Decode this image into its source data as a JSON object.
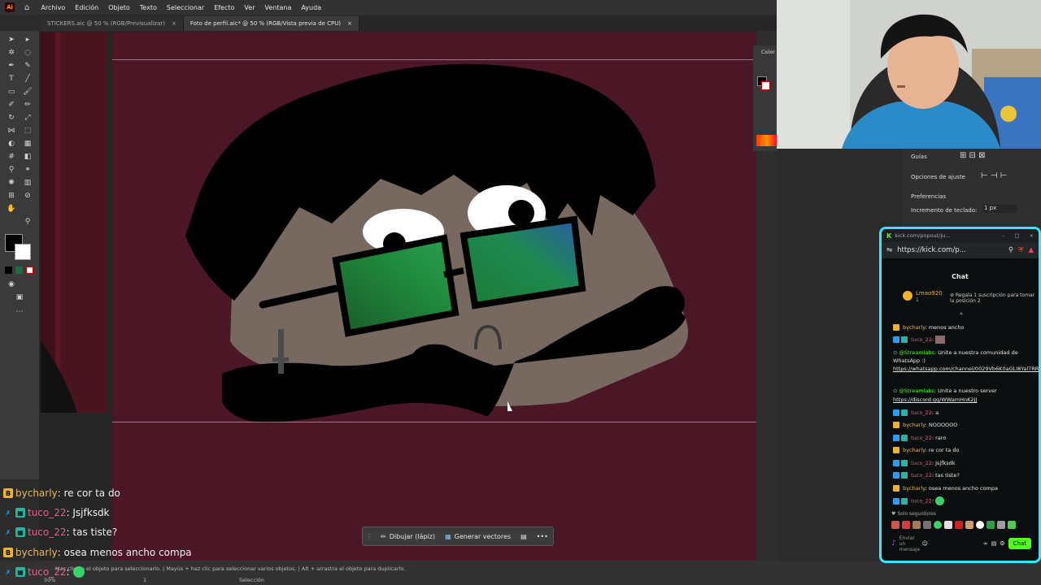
{
  "menubar": {
    "logo": "Ai",
    "items": [
      "Archivo",
      "Edición",
      "Objeto",
      "Texto",
      "Seleccionar",
      "Efecto",
      "Ver",
      "Ventana",
      "Ayuda"
    ]
  },
  "tabs": [
    {
      "label": "STICKERS.aic @ 50 % (RGB/Previsualizar)",
      "close": "×"
    },
    {
      "label": "Foto de perfil.aic* @ 50 % (RGB/Vista previa de CPU)",
      "close": "×"
    }
  ],
  "context_bar": {
    "draw_label": "Dibujar (lápiz)",
    "vectors_label": "Generar vectores",
    "more": "•••"
  },
  "color_panel": {
    "title": "Color"
  },
  "properties": {
    "guides": "Guías",
    "snap_options": "Opciones de ajuste",
    "preferences": "Preferencias",
    "keyboard_increment": "Incremento de teclado:",
    "increment_value": "1 px"
  },
  "status": {
    "zoom": "50%",
    "artboard_num": "1",
    "selection": "Selección",
    "hint": "Mas clic en el objeto para seleccionarlo. | Mayús + haz clic para seleccionar varios objetos. | Alt + arrastra el objeto para duplicarlo."
  },
  "overlay_chat": [
    {
      "user": "bycharly",
      "text": ": re cor ta do",
      "user_color": "#e8b85a",
      "badge": "#f0b030"
    },
    {
      "user": "tuco_22",
      "text": ": Jsjfksdk",
      "user_color": "#e0608a",
      "badge": "#2a9df4"
    },
    {
      "user": "tuco_22",
      "text": ": tas tiste?",
      "user_color": "#e0608a",
      "badge": "#2a9df4"
    },
    {
      "user": "bycharly",
      "text": ": osea menos ancho compa",
      "user_color": "#e8b85a",
      "badge": "#f0b030"
    },
    {
      "user": "tuco_22",
      "text": ":",
      "user_color": "#e0608a",
      "badge": "#2a9df4"
    }
  ],
  "kick": {
    "window_title": "kick.com/popout/ju...",
    "url": "https://kick.com/p...",
    "chat_header": "Chat",
    "leader_name": "Lmao920",
    "leader_count": "1",
    "gift_text": "Regala 1 suscripción para tomar la posición 2",
    "messages": [
      {
        "user": "bycharly",
        "text": ": menos ancho",
        "color": "#e8b85a"
      },
      {
        "user": "tuco_22",
        "text": ":",
        "color": "#e0608a"
      },
      {
        "user": "@Streamlabs",
        "text": ": Unite a nuestra comunidad de WhatsApp :)",
        "color": "#53fc18"
      },
      {
        "user": "",
        "text": "https://whatsapp.com/channel/0029Vb6K0aGLI8Yal7RR4P0h",
        "color": "#ffffff"
      },
      {
        "user": "@Streamlabs",
        "text": ": Unite a nuestro server",
        "color": "#53fc18"
      },
      {
        "user": "",
        "text": "https://discord.gg/WWamHnK2JJ",
        "color": "#ffffff"
      },
      {
        "user": "tuco_22",
        "text": ": a",
        "color": "#e0608a"
      },
      {
        "user": "bycharly",
        "text": ": NOOOOOO",
        "color": "#e8b85a"
      },
      {
        "user": "tuco_22",
        "text": ": raro",
        "color": "#e0608a"
      },
      {
        "user": "bycharly",
        "text": ": re cor ta do",
        "color": "#e8b85a"
      },
      {
        "user": "tuco_22",
        "text": ": Jsjfksdk",
        "color": "#e0608a"
      },
      {
        "user": "tuco_22",
        "text": ": tas tiste?",
        "color": "#e0608a"
      },
      {
        "user": "bycharly",
        "text": ": osea menos ancho compa",
        "color": "#e8b85a"
      },
      {
        "user": "tuco_22",
        "text": ":",
        "color": "#e0608a"
      }
    ],
    "followers_only": "Solo seguidores",
    "input_placeholder": "Enviar un mensaje",
    "send_label": "Chat"
  },
  "colors": {
    "accent_kick": "#53fc18",
    "artboard": "#4b1727",
    "kick_border": "#2eeaff"
  }
}
